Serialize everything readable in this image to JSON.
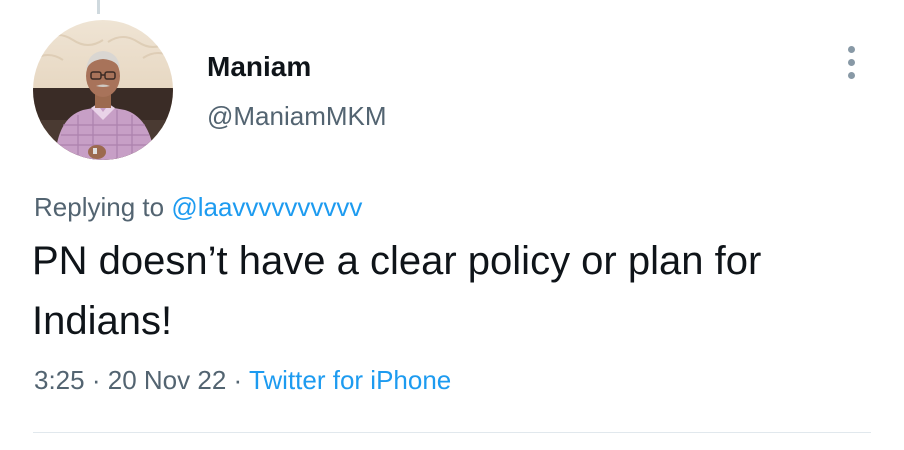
{
  "tweet": {
    "author": {
      "display_name": "Maniam",
      "handle": "@ManiamMKM"
    },
    "reply": {
      "prefix": "Replying to",
      "mention": "@laavvvvvvvvvv"
    },
    "text": "PN doesn’t have a clear policy or plan for Indians!",
    "meta": {
      "time": "3:25",
      "separator_1": "·",
      "date": "20 Nov 22",
      "separator_2": "·",
      "source": "Twitter for iPhone"
    }
  },
  "colors": {
    "link": "#1d9bf0",
    "secondary_text": "#536471",
    "primary_text": "#0f1419",
    "divider": "#e1e8ed"
  },
  "icons": {
    "more": "more-vertical-icon"
  }
}
